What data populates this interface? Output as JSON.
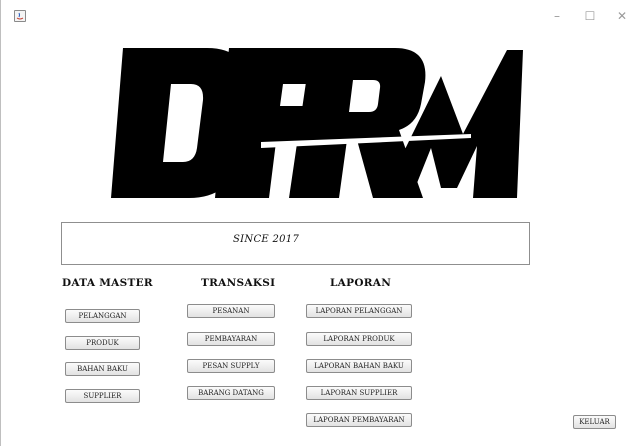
{
  "window": {
    "controls": {
      "minimize": "–",
      "maximize": "☐",
      "close": "✕"
    }
  },
  "logo": {
    "text": "DFRM"
  },
  "since": "SINCE 2017",
  "sections": {
    "master": {
      "heading": "DATA MASTER",
      "buttons": [
        "PELANGGAN",
        "PRODUK",
        "BAHAN BAKU",
        "SUPPLIER"
      ]
    },
    "transaksi": {
      "heading": "TRANSAKSI",
      "buttons": [
        "PESANAN",
        "PEMBAYARAN",
        "PESAN SUPPLY",
        "BARANG DATANG"
      ]
    },
    "laporan": {
      "heading": "LAPORAN",
      "buttons": [
        "LAPORAN PELANGGAN",
        "LAPORAN PRODUK",
        "LAPORAN BAHAN BAKU",
        "LAPORAN SUPPLIER",
        "LAPORAN PEMBAYARAN"
      ]
    }
  },
  "exit_button": "KELUAR",
  "icons": {
    "app": "java-app-icon",
    "minimize": "minimize-icon",
    "maximize": "maximize-icon",
    "close": "close-icon"
  }
}
